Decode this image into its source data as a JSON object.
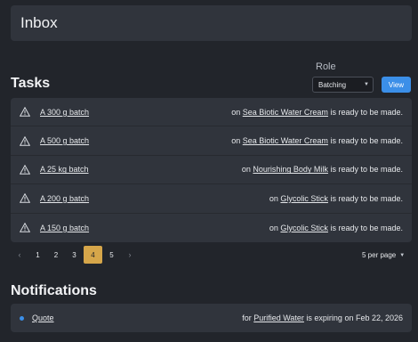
{
  "inbox": {
    "title": "Inbox"
  },
  "tasks": {
    "title": "Tasks",
    "role_label": "Role",
    "role_value": "Batching",
    "view_label": "View",
    "rows": [
      {
        "link": "A 300 g batch",
        "prefix": "on",
        "product": "Sea Biotic Water Cream",
        "suffix": "is ready to be made."
      },
      {
        "link": "A 500 g batch",
        "prefix": "on",
        "product": "Sea Biotic Water Cream",
        "suffix": "is ready to be made."
      },
      {
        "link": "A 25 kg batch",
        "prefix": "on",
        "product": "Nourishing Body Milk",
        "suffix": "is ready to be made."
      },
      {
        "link": "A 200 g batch",
        "prefix": "on",
        "product": "Glycolic Stick",
        "suffix": "is ready to be made."
      },
      {
        "link": "A 150 g batch",
        "prefix": "on",
        "product": "Glycolic Stick",
        "suffix": "is ready to be made."
      }
    ]
  },
  "pagination": {
    "prev": "‹",
    "pages": [
      "1",
      "2",
      "3",
      "4",
      "5"
    ],
    "active_page": "4",
    "next": "›",
    "per_page": "5 per page"
  },
  "notifications": {
    "title": "Notifications",
    "items": [
      {
        "link": "Quote",
        "prefix": "for",
        "product": "Purified Water",
        "suffix": "is expiring on Feb 22, 2026"
      }
    ]
  },
  "colors": {
    "accent": "#3b8fe8",
    "active_page": "#d6a64a",
    "panel": "#30343c",
    "background": "#22252b"
  }
}
